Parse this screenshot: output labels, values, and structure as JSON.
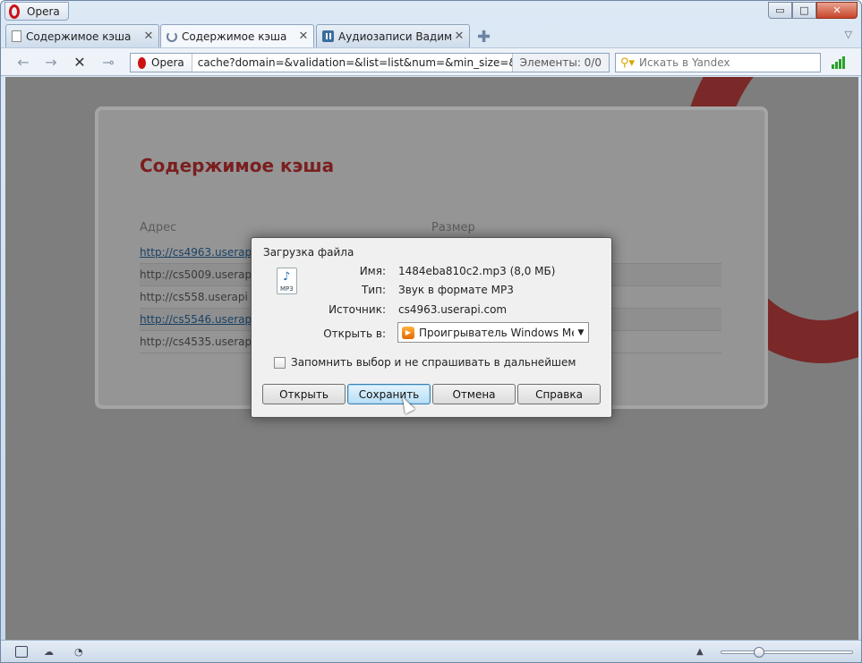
{
  "window": {
    "app_button": "Opera",
    "min_symbol": "▭",
    "max_symbol": "□",
    "close_symbol": "✕"
  },
  "tabs": [
    {
      "label": "Содержимое кэша",
      "close": "✕"
    },
    {
      "label": "Содержимое кэша",
      "close": "✕"
    },
    {
      "label": "Аудиозаписи Вадима ...",
      "close": "✕"
    }
  ],
  "toolbar": {
    "back": "←",
    "forward": "→",
    "stop": "✕",
    "key": "⊸",
    "badge": "Opera",
    "url": "cache?domain=&validation=&list=list&num=&min_size=&max_si",
    "elements_count": "Элементы:   0/0",
    "search_placeholder": "Искать в Yandex",
    "search_engine_icon": "magnifier-icon"
  },
  "page": {
    "title": "Содержимое кэша",
    "col_address": "Адрес",
    "col_size": "Размер",
    "rows": [
      {
        "address": "http://cs4963.userap",
        "link": true
      },
      {
        "address": "http://cs5009.userap",
        "link": false
      },
      {
        "address": "http://cs558.userapi",
        "link": false
      },
      {
        "address": "http://cs5546.userap",
        "link": true
      },
      {
        "address": "http://cs4535.userap",
        "link": false
      }
    ]
  },
  "dialog": {
    "title": "Загрузка файла",
    "file_icon_label": "MP3",
    "name_label": "Имя:",
    "name_value": "1484eba810c2.mp3 (8,0 МБ)",
    "type_label": "Тип:",
    "type_value": "Звук в формате MP3",
    "source_label": "Источник:",
    "source_value": "cs4963.userapi.com",
    "open_in_label": "Открыть в:",
    "open_in_value": "Проигрыватель Windows Media",
    "remember_label": "Запомнить выбор и не спрашивать в дальнейшем",
    "remember_checked": false,
    "btn_open": "Открыть",
    "btn_save": "Сохранить",
    "btn_cancel": "Отмена",
    "btn_help": "Справка"
  },
  "colors": {
    "opera_red": "#cc1111",
    "page_title": "#7a1f1f",
    "link": "#1a4266",
    "overlay": "#7e7e7e"
  }
}
